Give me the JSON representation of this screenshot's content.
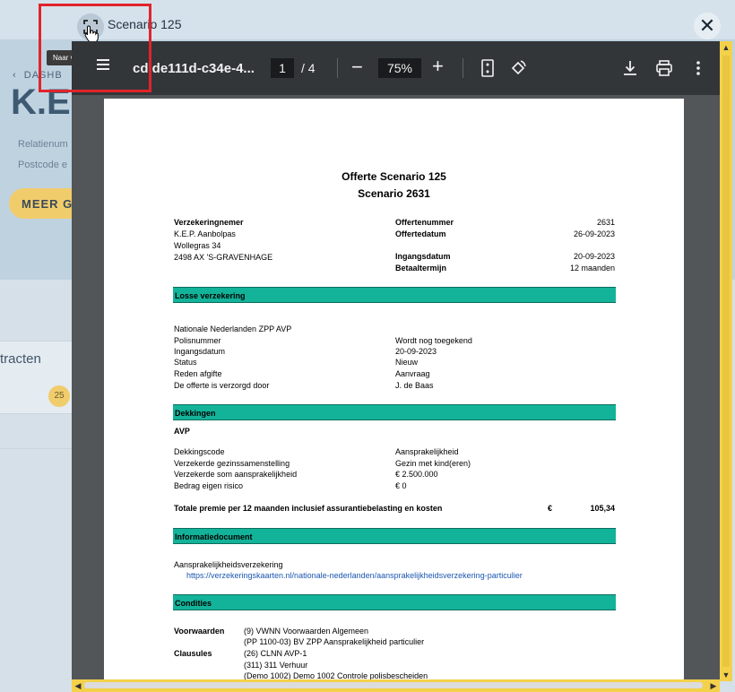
{
  "background": {
    "back_label": "DASHB",
    "big_title": "K.E.",
    "line1": "Relatienum",
    "line2": "Postcode e",
    "more_button": "MEER G",
    "card_title": "tracten",
    "badge": "25"
  },
  "modal": {
    "title": "Scenario 125",
    "fullscreen_tooltip": "Naar volledig scherm",
    "close_label": "✕"
  },
  "viewer": {
    "filename": "cd de111d-c34e-4...",
    "page_current": "1",
    "page_count": "/ 4",
    "zoom": "75%"
  },
  "document": {
    "title": "Offerte Scenario 125",
    "subtitle": "Scenario 2631",
    "holder_label": "Verzekeringnemer",
    "holder_name": "K.E.P. Aanbolpas",
    "holder_street": "Wollegras 34",
    "holder_city": "2498 AX  'S-GRAVENHAGE",
    "offer_no_label": "Offertenummer",
    "offer_no": "2631",
    "offer_date_label": "Offertedatum",
    "offer_date": "26-09-2023",
    "start_label": "Ingangsdatum",
    "start_date": "20-09-2023",
    "term_label": "Betaaltermijn",
    "term": "12 maanden",
    "section_losse": "Losse verzekering",
    "product": "Nationale Nederlanden ZPP AVP",
    "polis_label": "Polisnummer",
    "polis_value": "Wordt nog toegekend",
    "ingang_label": "Ingangsdatum",
    "ingang_value": "20-09-2023",
    "status_label": "Status",
    "status_value": "Nieuw",
    "reden_label": "Reden afgifte",
    "reden_value": "Aanvraag",
    "verzorgd_label": "De offerte is verzorgd door",
    "verzorgd_value": "J. de Baas",
    "section_dekkingen": "Dekkingen",
    "avp": "AVP",
    "code_label": "Dekkingscode",
    "code_value": "Aansprakelijkheid",
    "gezin_label": "Verzekerde gezinssamenstelling",
    "gezin_value": "Gezin met kind(eren)",
    "som_label": "Verzekerde som aansprakelijkheid",
    "som_value": "€ 2.500.000",
    "eigen_label": "Bedrag eigen risico",
    "eigen_value": "€ 0",
    "premie_label": "Totale premie per 12 maanden inclusief assurantiebelasting en kosten",
    "premie_currency": "€",
    "premie_value": "105,34",
    "section_info": "Informatiedocument",
    "info_item": "Aansprakelijkheidsverzekering",
    "info_link": "https://verzekeringskaarten.nl/nationale-nederlanden/aansprakelijkheidsverzekering-particulier",
    "section_condities": "Condities",
    "voorwaarden_label": "Voorwaarden",
    "voorwaarden_1": "(9)  VWNN Voorwaarden Algemeen",
    "voorwaarden_2": "(PP 1100-03)  BV ZPP Aansprakelijkheid particulier",
    "clausules_label": "Clausules",
    "clausule_1": "(26)  CLNN AVP-1",
    "clausule_2": "(311)  311 Verhuur",
    "clausule_3": "(Demo 1002)  Demo 1002 Controle polisbescheiden"
  }
}
